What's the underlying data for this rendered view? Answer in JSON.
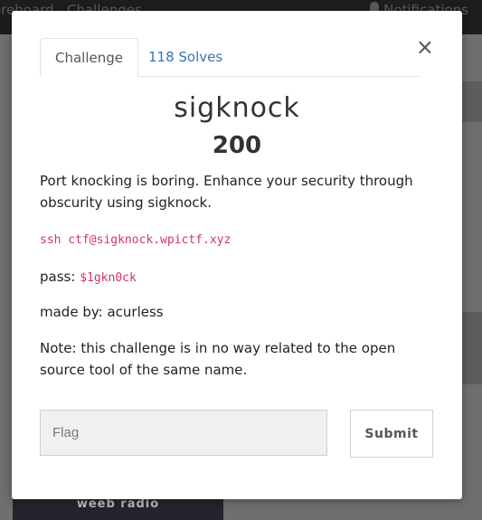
{
  "navbar": {
    "scoreboard": "oreboard",
    "challenges": "Challenges",
    "notifications": "Notifications"
  },
  "sidebar": {
    "radio": "weeb radio"
  },
  "modal": {
    "close_label": "×",
    "tabs": [
      {
        "label": "Challenge",
        "active": true
      },
      {
        "label": "118 Solves",
        "active": false
      }
    ],
    "title": "sigknock",
    "points": "200",
    "description": {
      "intro": "Port knocking is boring. Enhance your security through obscurity using sigknock.",
      "ssh_command": "ssh ctf@sigknock.wpictf.xyz",
      "pass_label": "pass:",
      "pass_value": "$1gkn0ck",
      "author": "made by: acurless",
      "note": "Note: this challenge is in no way related to the open source tool of the same name."
    },
    "flag_placeholder": "Flag",
    "flag_value": "",
    "submit_label": "Submit"
  },
  "colors": {
    "link": "#3a72b5",
    "code": "#d6336c",
    "backdrop": "#6f6f6f"
  }
}
